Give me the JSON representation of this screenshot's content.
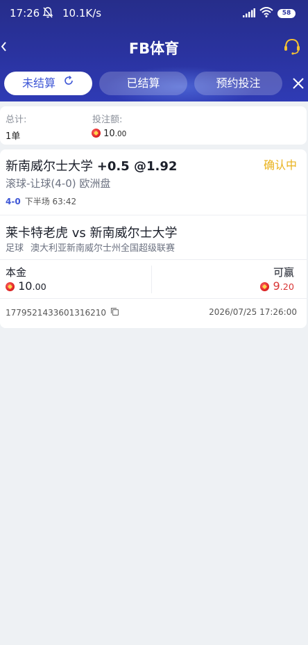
{
  "status_bar": {
    "time": "17:26",
    "speed": "10.1K/s",
    "battery": "58"
  },
  "nav": {
    "title": "FB体育",
    "back_icon": "chevron-left-icon",
    "support_icon": "headset-icon"
  },
  "tabs": [
    {
      "label": "未结算",
      "active": true
    },
    {
      "label": "已结算",
      "active": false
    },
    {
      "label": "预约投注",
      "active": false
    }
  ],
  "summary": {
    "total_label": "总计:",
    "total_value": "1单",
    "stake_label": "投注额:",
    "stake_value_int": "10",
    "stake_value_dec": ".00"
  },
  "bet": {
    "selection": "新南威尔士大学",
    "handicap": "+0.5 @1.92",
    "status": "确认中",
    "market": "滚球-让球(4-0) 欧洲盘",
    "score": "4-0",
    "period": "下半场 63:42",
    "match": "莱卡特老虎 vs 新南威尔士大学",
    "sport": "足球",
    "league": "澳大利亚新南威尔士州全国超级联赛",
    "stake_label": "本金",
    "stake_int": "10",
    "stake_dec": ".00",
    "win_label": "可赢",
    "win_int": "9",
    "win_dec": ".20",
    "order_id": "1779521433601316210",
    "order_time": "2026/07/25 17:26:00"
  },
  "colors": {
    "header": "#2a33a0",
    "accent": "#3d56d6",
    "status_pending": "#e9b21d",
    "win": "#d93636"
  }
}
